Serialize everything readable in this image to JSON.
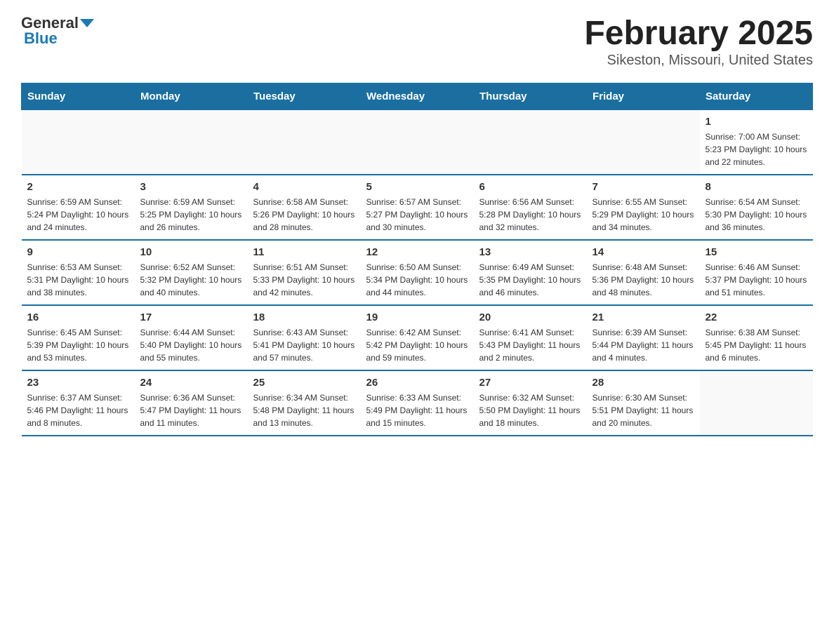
{
  "logo": {
    "general": "General",
    "blue": "Blue"
  },
  "title": "February 2025",
  "subtitle": "Sikeston, Missouri, United States",
  "days_of_week": [
    "Sunday",
    "Monday",
    "Tuesday",
    "Wednesday",
    "Thursday",
    "Friday",
    "Saturday"
  ],
  "weeks": [
    [
      {
        "day": "",
        "info": ""
      },
      {
        "day": "",
        "info": ""
      },
      {
        "day": "",
        "info": ""
      },
      {
        "day": "",
        "info": ""
      },
      {
        "day": "",
        "info": ""
      },
      {
        "day": "",
        "info": ""
      },
      {
        "day": "1",
        "info": "Sunrise: 7:00 AM\nSunset: 5:23 PM\nDaylight: 10 hours and 22 minutes."
      }
    ],
    [
      {
        "day": "2",
        "info": "Sunrise: 6:59 AM\nSunset: 5:24 PM\nDaylight: 10 hours and 24 minutes."
      },
      {
        "day": "3",
        "info": "Sunrise: 6:59 AM\nSunset: 5:25 PM\nDaylight: 10 hours and 26 minutes."
      },
      {
        "day": "4",
        "info": "Sunrise: 6:58 AM\nSunset: 5:26 PM\nDaylight: 10 hours and 28 minutes."
      },
      {
        "day": "5",
        "info": "Sunrise: 6:57 AM\nSunset: 5:27 PM\nDaylight: 10 hours and 30 minutes."
      },
      {
        "day": "6",
        "info": "Sunrise: 6:56 AM\nSunset: 5:28 PM\nDaylight: 10 hours and 32 minutes."
      },
      {
        "day": "7",
        "info": "Sunrise: 6:55 AM\nSunset: 5:29 PM\nDaylight: 10 hours and 34 minutes."
      },
      {
        "day": "8",
        "info": "Sunrise: 6:54 AM\nSunset: 5:30 PM\nDaylight: 10 hours and 36 minutes."
      }
    ],
    [
      {
        "day": "9",
        "info": "Sunrise: 6:53 AM\nSunset: 5:31 PM\nDaylight: 10 hours and 38 minutes."
      },
      {
        "day": "10",
        "info": "Sunrise: 6:52 AM\nSunset: 5:32 PM\nDaylight: 10 hours and 40 minutes."
      },
      {
        "day": "11",
        "info": "Sunrise: 6:51 AM\nSunset: 5:33 PM\nDaylight: 10 hours and 42 minutes."
      },
      {
        "day": "12",
        "info": "Sunrise: 6:50 AM\nSunset: 5:34 PM\nDaylight: 10 hours and 44 minutes."
      },
      {
        "day": "13",
        "info": "Sunrise: 6:49 AM\nSunset: 5:35 PM\nDaylight: 10 hours and 46 minutes."
      },
      {
        "day": "14",
        "info": "Sunrise: 6:48 AM\nSunset: 5:36 PM\nDaylight: 10 hours and 48 minutes."
      },
      {
        "day": "15",
        "info": "Sunrise: 6:46 AM\nSunset: 5:37 PM\nDaylight: 10 hours and 51 minutes."
      }
    ],
    [
      {
        "day": "16",
        "info": "Sunrise: 6:45 AM\nSunset: 5:39 PM\nDaylight: 10 hours and 53 minutes."
      },
      {
        "day": "17",
        "info": "Sunrise: 6:44 AM\nSunset: 5:40 PM\nDaylight: 10 hours and 55 minutes."
      },
      {
        "day": "18",
        "info": "Sunrise: 6:43 AM\nSunset: 5:41 PM\nDaylight: 10 hours and 57 minutes."
      },
      {
        "day": "19",
        "info": "Sunrise: 6:42 AM\nSunset: 5:42 PM\nDaylight: 10 hours and 59 minutes."
      },
      {
        "day": "20",
        "info": "Sunrise: 6:41 AM\nSunset: 5:43 PM\nDaylight: 11 hours and 2 minutes."
      },
      {
        "day": "21",
        "info": "Sunrise: 6:39 AM\nSunset: 5:44 PM\nDaylight: 11 hours and 4 minutes."
      },
      {
        "day": "22",
        "info": "Sunrise: 6:38 AM\nSunset: 5:45 PM\nDaylight: 11 hours and 6 minutes."
      }
    ],
    [
      {
        "day": "23",
        "info": "Sunrise: 6:37 AM\nSunset: 5:46 PM\nDaylight: 11 hours and 8 minutes."
      },
      {
        "day": "24",
        "info": "Sunrise: 6:36 AM\nSunset: 5:47 PM\nDaylight: 11 hours and 11 minutes."
      },
      {
        "day": "25",
        "info": "Sunrise: 6:34 AM\nSunset: 5:48 PM\nDaylight: 11 hours and 13 minutes."
      },
      {
        "day": "26",
        "info": "Sunrise: 6:33 AM\nSunset: 5:49 PM\nDaylight: 11 hours and 15 minutes."
      },
      {
        "day": "27",
        "info": "Sunrise: 6:32 AM\nSunset: 5:50 PM\nDaylight: 11 hours and 18 minutes."
      },
      {
        "day": "28",
        "info": "Sunrise: 6:30 AM\nSunset: 5:51 PM\nDaylight: 11 hours and 20 minutes."
      },
      {
        "day": "",
        "info": ""
      }
    ]
  ]
}
